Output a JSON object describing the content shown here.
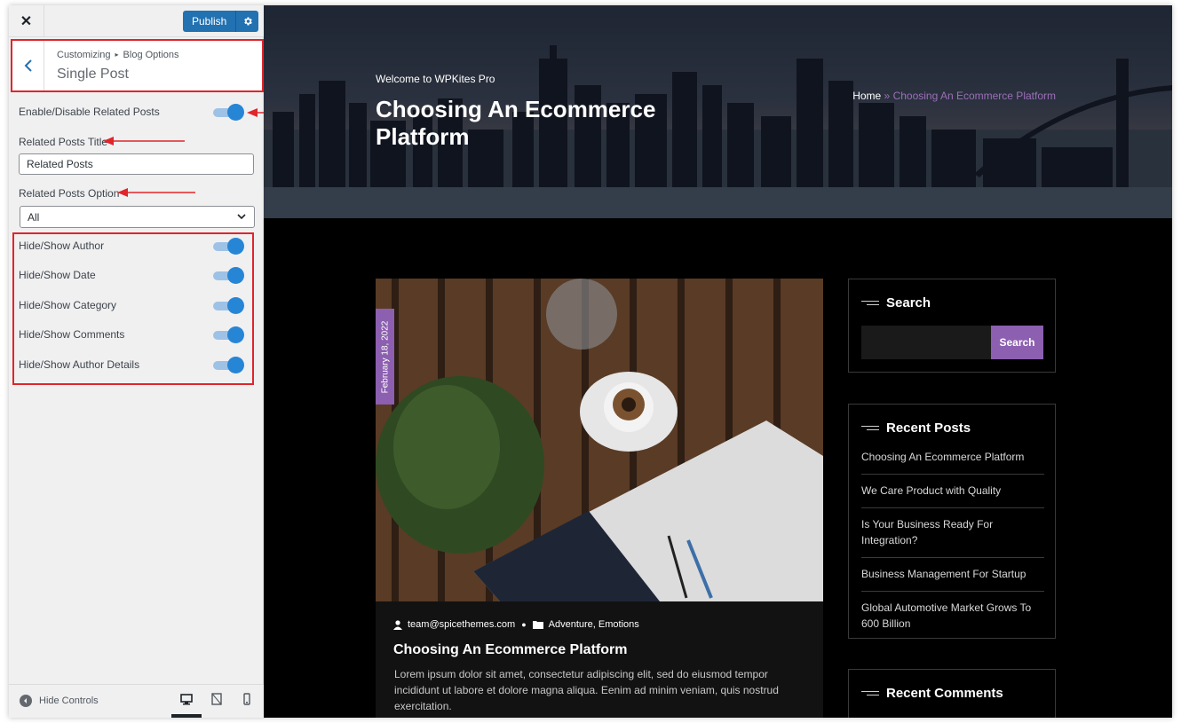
{
  "customizer": {
    "close_label": "✕",
    "publish_label": "Publish",
    "breadcrumb": [
      "Customizing",
      "Blog Options"
    ],
    "section_title": "Single Post",
    "related_toggle_label": "Enable/Disable Related Posts",
    "related_toggle_on": true,
    "related_title_label": "Related Posts Title",
    "related_title_value": "Related Posts",
    "related_option_label": "Related Posts Option",
    "related_option_value": "All",
    "toggles": [
      {
        "label": "Hide/Show Author",
        "on": true
      },
      {
        "label": "Hide/Show Date",
        "on": true
      },
      {
        "label": "Hide/Show Category",
        "on": true
      },
      {
        "label": "Hide/Show Comments",
        "on": true
      },
      {
        "label": "Hide/Show Author Details",
        "on": true
      }
    ],
    "hide_controls_label": "Hide Controls",
    "devices": [
      "desktop-icon",
      "tablet-icon",
      "mobile-icon"
    ],
    "accent_color": "#2271b1",
    "annotation_color": "#e0252b"
  },
  "preview": {
    "welcome": "Welcome to WPKites Pro",
    "hero_title": "Choosing An Ecommerce Platform",
    "breadcrumb_home": "Home",
    "breadcrumb_sep": "»",
    "breadcrumb_current": "Choosing An Ecommerce Platform",
    "post": {
      "date": "February 18, 2022",
      "author": "team@spicethemes.com",
      "categories": "Adventure, Emotions",
      "title": "Choosing An Ecommerce Platform",
      "excerpt": "Lorem ipsum dolor sit amet, consectetur adipiscing elit, sed do eiusmod tempor incididunt ut labore et dolore magna aliqua. Eenim ad minim veniam, quis nostrud exercitation."
    },
    "search_widget": {
      "title": "Search",
      "button": "Search"
    },
    "recent_posts_widget": {
      "title": "Recent Posts",
      "items": [
        "Choosing An Ecommerce Platform",
        "We Care Product with Quality",
        "Is Your Business Ready For Integration?",
        "Business Management For Startup",
        "Global Automotive Market Grows To 600 Billion"
      ]
    },
    "recent_comments_widget": {
      "title": "Recent Comments"
    },
    "accent_color": "#8c5fb0"
  }
}
